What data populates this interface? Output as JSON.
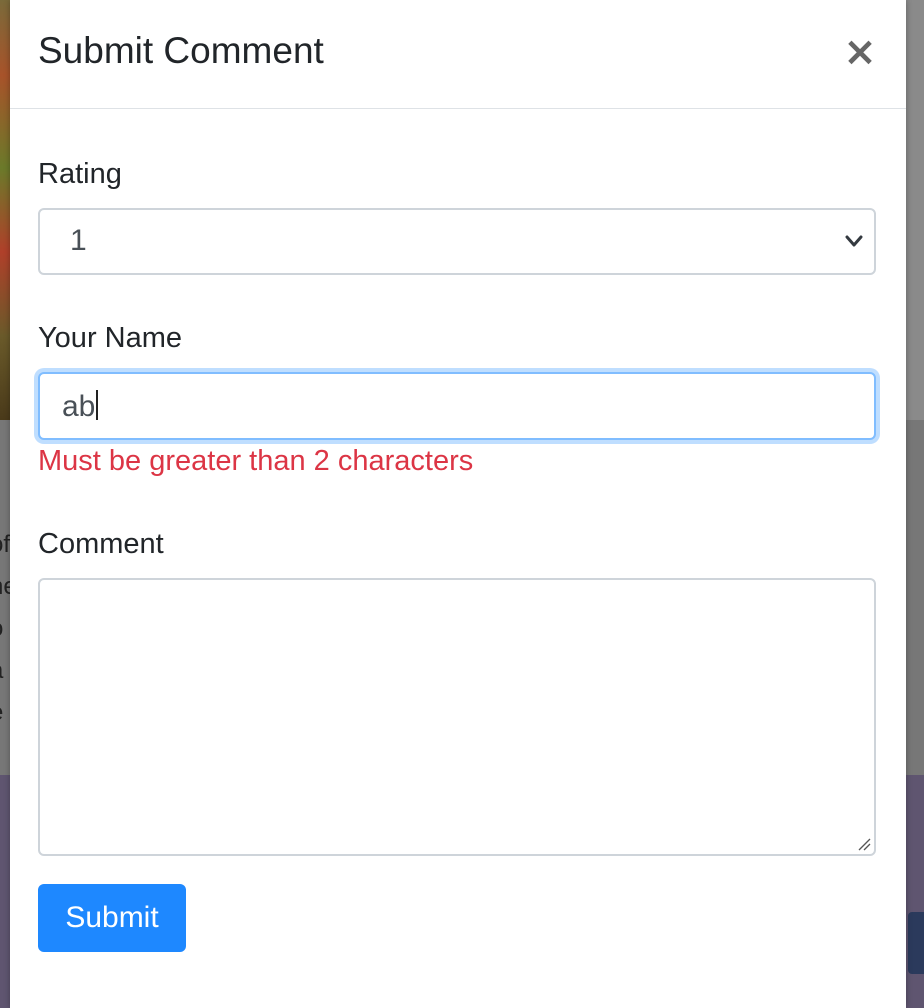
{
  "modal": {
    "title": "Submit Comment",
    "close_symbol": "×",
    "close_icon": "close-icon"
  },
  "form": {
    "rating": {
      "label": "Rating",
      "selected_value": "1",
      "icon": "chevron-down-icon"
    },
    "name": {
      "label": "Your Name",
      "value": "ab",
      "error": "Must be greater than 2 characters"
    },
    "comment": {
      "label": "Comment",
      "value": "",
      "icon": "resize-handle-icon"
    },
    "submit_label": "Submit"
  },
  "background": {
    "text_fragments": [
      "of",
      "ne",
      "o",
      "a",
      "e"
    ]
  },
  "colors": {
    "primary": "#1e88ff",
    "error": "#dc3545",
    "focus_border": "#80bdff"
  }
}
